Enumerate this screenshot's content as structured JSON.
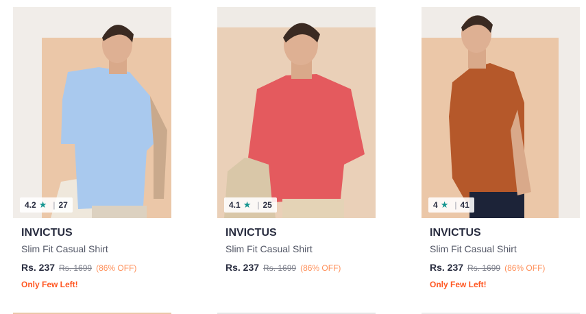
{
  "products": [
    {
      "brand": "INVICTUS",
      "name": "Slim Fit Casual Shirt",
      "rating": "4.2",
      "rating_count": "27",
      "price": "Rs. 237",
      "mrp": "Rs. 1699",
      "discount": "(86% OFF)",
      "stock_note": "Only Few Left!",
      "shirt_color": "#a9c9ee"
    },
    {
      "brand": "INVICTUS",
      "name": "Slim Fit Casual Shirt",
      "rating": "4.1",
      "rating_count": "25",
      "price": "Rs. 237",
      "mrp": "Rs. 1699",
      "discount": "(86% OFF)",
      "stock_note": "",
      "shirt_color": "#e45a5e"
    },
    {
      "brand": "INVICTUS",
      "name": "Slim Fit Casual Shirt",
      "rating": "4",
      "rating_count": "41",
      "price": "Rs. 237",
      "mrp": "Rs. 1699",
      "discount": "(86% OFF)",
      "stock_note": "Only Few Left!",
      "shirt_color": "#b5582a"
    }
  ],
  "icons": {
    "rating": "star-icon"
  },
  "colors": {
    "rating_star": "#14958f",
    "discount": "#ff905a",
    "stock": "#ff5722"
  }
}
